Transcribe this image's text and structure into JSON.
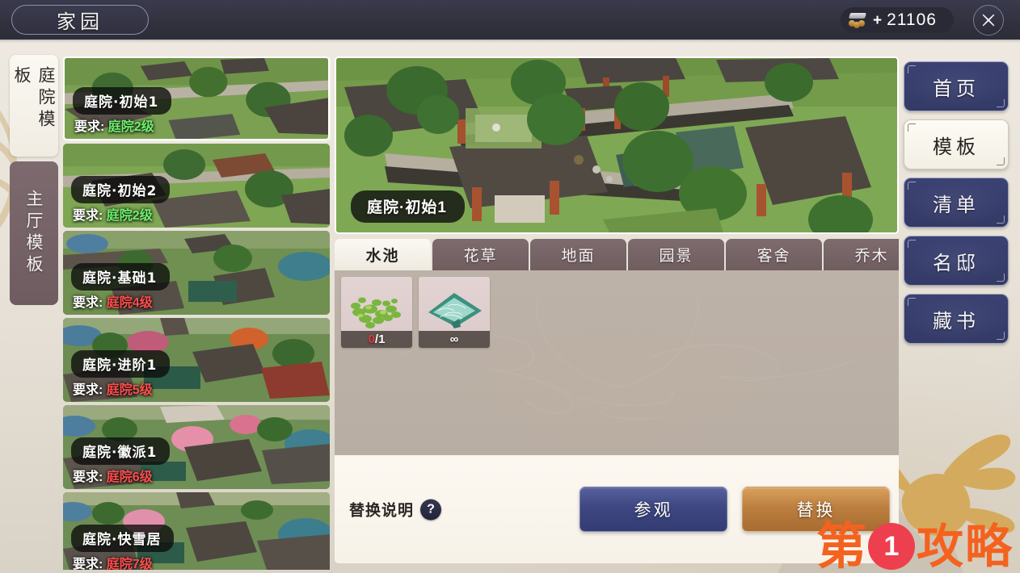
{
  "titlebar": {
    "title": "家园",
    "currency": {
      "icon": "coin-stack-icon",
      "plus": "+",
      "value": "21106"
    },
    "close_icon": "close-icon"
  },
  "left_tabs": [
    {
      "label": "庭院模板",
      "active": true
    },
    {
      "label": "主厅模板",
      "active": false
    }
  ],
  "templates": [
    {
      "name": "庭院·初始1",
      "req_label": "要求:",
      "req_value": "庭院2级",
      "locked": false,
      "selected": true
    },
    {
      "name": "庭院·初始2",
      "req_label": "要求:",
      "req_value": "庭院2级",
      "locked": false,
      "selected": false
    },
    {
      "name": "庭院·基础1",
      "req_label": "要求:",
      "req_value": "庭院4级",
      "locked": true,
      "selected": false
    },
    {
      "name": "庭院·进阶1",
      "req_label": "要求:",
      "req_value": "庭院5级",
      "locked": true,
      "selected": false
    },
    {
      "name": "庭院·徽派1",
      "req_label": "要求:",
      "req_value": "庭院6级",
      "locked": true,
      "selected": false
    },
    {
      "name": "庭院·快雪居",
      "req_label": "要求:",
      "req_value": "庭院7级",
      "locked": true,
      "selected": false
    }
  ],
  "preview": {
    "label": "庭院·初始1"
  },
  "category_tabs": [
    {
      "label": "水池",
      "active": true
    },
    {
      "label": "花草",
      "active": false
    },
    {
      "label": "地面",
      "active": false
    },
    {
      "label": "园景",
      "active": false
    },
    {
      "label": "客舍",
      "active": false
    },
    {
      "label": "乔木",
      "active": false
    }
  ],
  "items": [
    {
      "icon": "lily-pads-icon",
      "have": "0",
      "sep": "/",
      "need": "1",
      "zero": true
    },
    {
      "icon": "water-surface-icon",
      "count": "∞",
      "zero": false
    }
  ],
  "action_bar": {
    "help_text": "替换说明",
    "help_icon": "?",
    "visit_button": "参观",
    "replace_button": "替换"
  },
  "right_nav": [
    {
      "label": "首页",
      "active": false
    },
    {
      "label": "模板",
      "active": true
    },
    {
      "label": "清单",
      "active": false
    },
    {
      "label": "名邸",
      "active": false
    },
    {
      "label": "藏书",
      "active": false
    }
  ],
  "watermark": {
    "prefix": "第",
    "number": "1",
    "suffix": "攻略"
  },
  "colors": {
    "accent_blue": "#3b4273",
    "accent_orange": "#bd7f3f",
    "req_ok": "#6ef06e",
    "req_locked": "#ff4d4d",
    "watermark_orange": "#f4621f",
    "watermark_red": "#ee3f4f"
  }
}
